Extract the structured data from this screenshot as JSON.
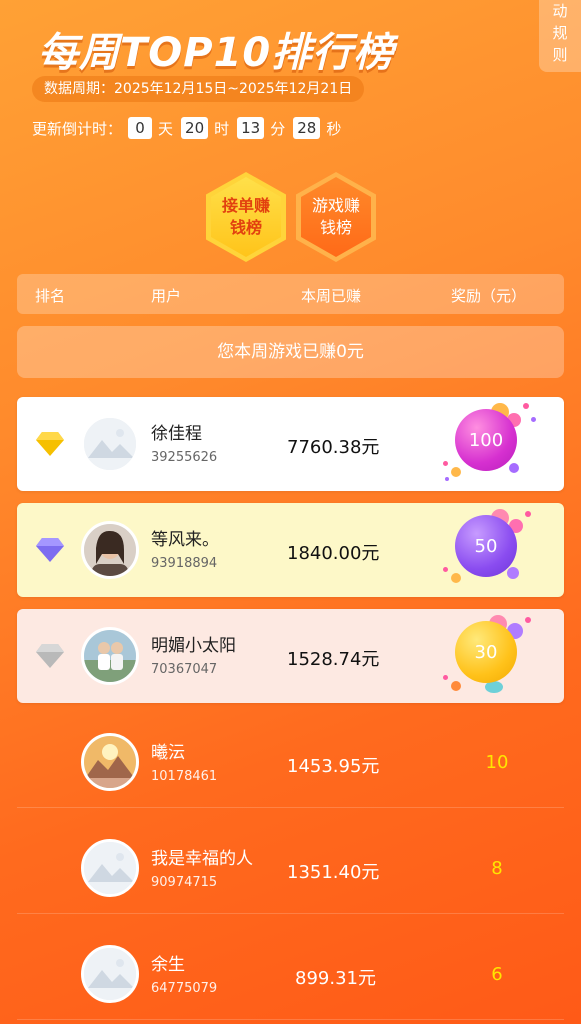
{
  "rules_tab": [
    "动",
    "规",
    "则"
  ],
  "title": "每周TOP10排行榜",
  "period": "数据周期：2025年12月15日~2025年12月21日",
  "countdown": {
    "label": "更新倒计时：",
    "days": "0",
    "days_unit": "天",
    "hours": "20",
    "hours_unit": "时",
    "minutes": "13",
    "minutes_unit": "分",
    "seconds": "28",
    "seconds_unit": "秒"
  },
  "tabs": [
    {
      "line1": "接单赚",
      "line2": "钱榜"
    },
    {
      "line1": "游戏赚",
      "line2": "钱榜"
    }
  ],
  "table_header": {
    "rank": "排名",
    "user": "用户",
    "earned": "本周已赚",
    "reward": "奖励（元）"
  },
  "my_earnings": "您本周游戏已赚0元",
  "rows": [
    {
      "name": "徐佳程",
      "uid": "39255626",
      "earned": "7760.38元",
      "reward": "100",
      "rank_color": "#f6c000"
    },
    {
      "name": "等风来。",
      "uid": "93918894",
      "earned": "1840.00元",
      "reward": "50",
      "rank_color": "#7d6cf0"
    },
    {
      "name": "明媚小太阳",
      "uid": "70367047",
      "earned": "1528.74元",
      "reward": "30",
      "rank_color": "#bcbcbc"
    },
    {
      "name": "曦沄",
      "uid": "10178461",
      "earned": "1453.95元",
      "reward": "10"
    },
    {
      "name": "我是幸福的人",
      "uid": "90974715",
      "earned": "1351.40元",
      "reward": "8"
    },
    {
      "name": "余生",
      "uid": "64775079",
      "earned": "899.31元",
      "reward": "6"
    }
  ],
  "colors": {
    "accent": "#ff6a1e",
    "reward_yellow": "#ffe600"
  }
}
